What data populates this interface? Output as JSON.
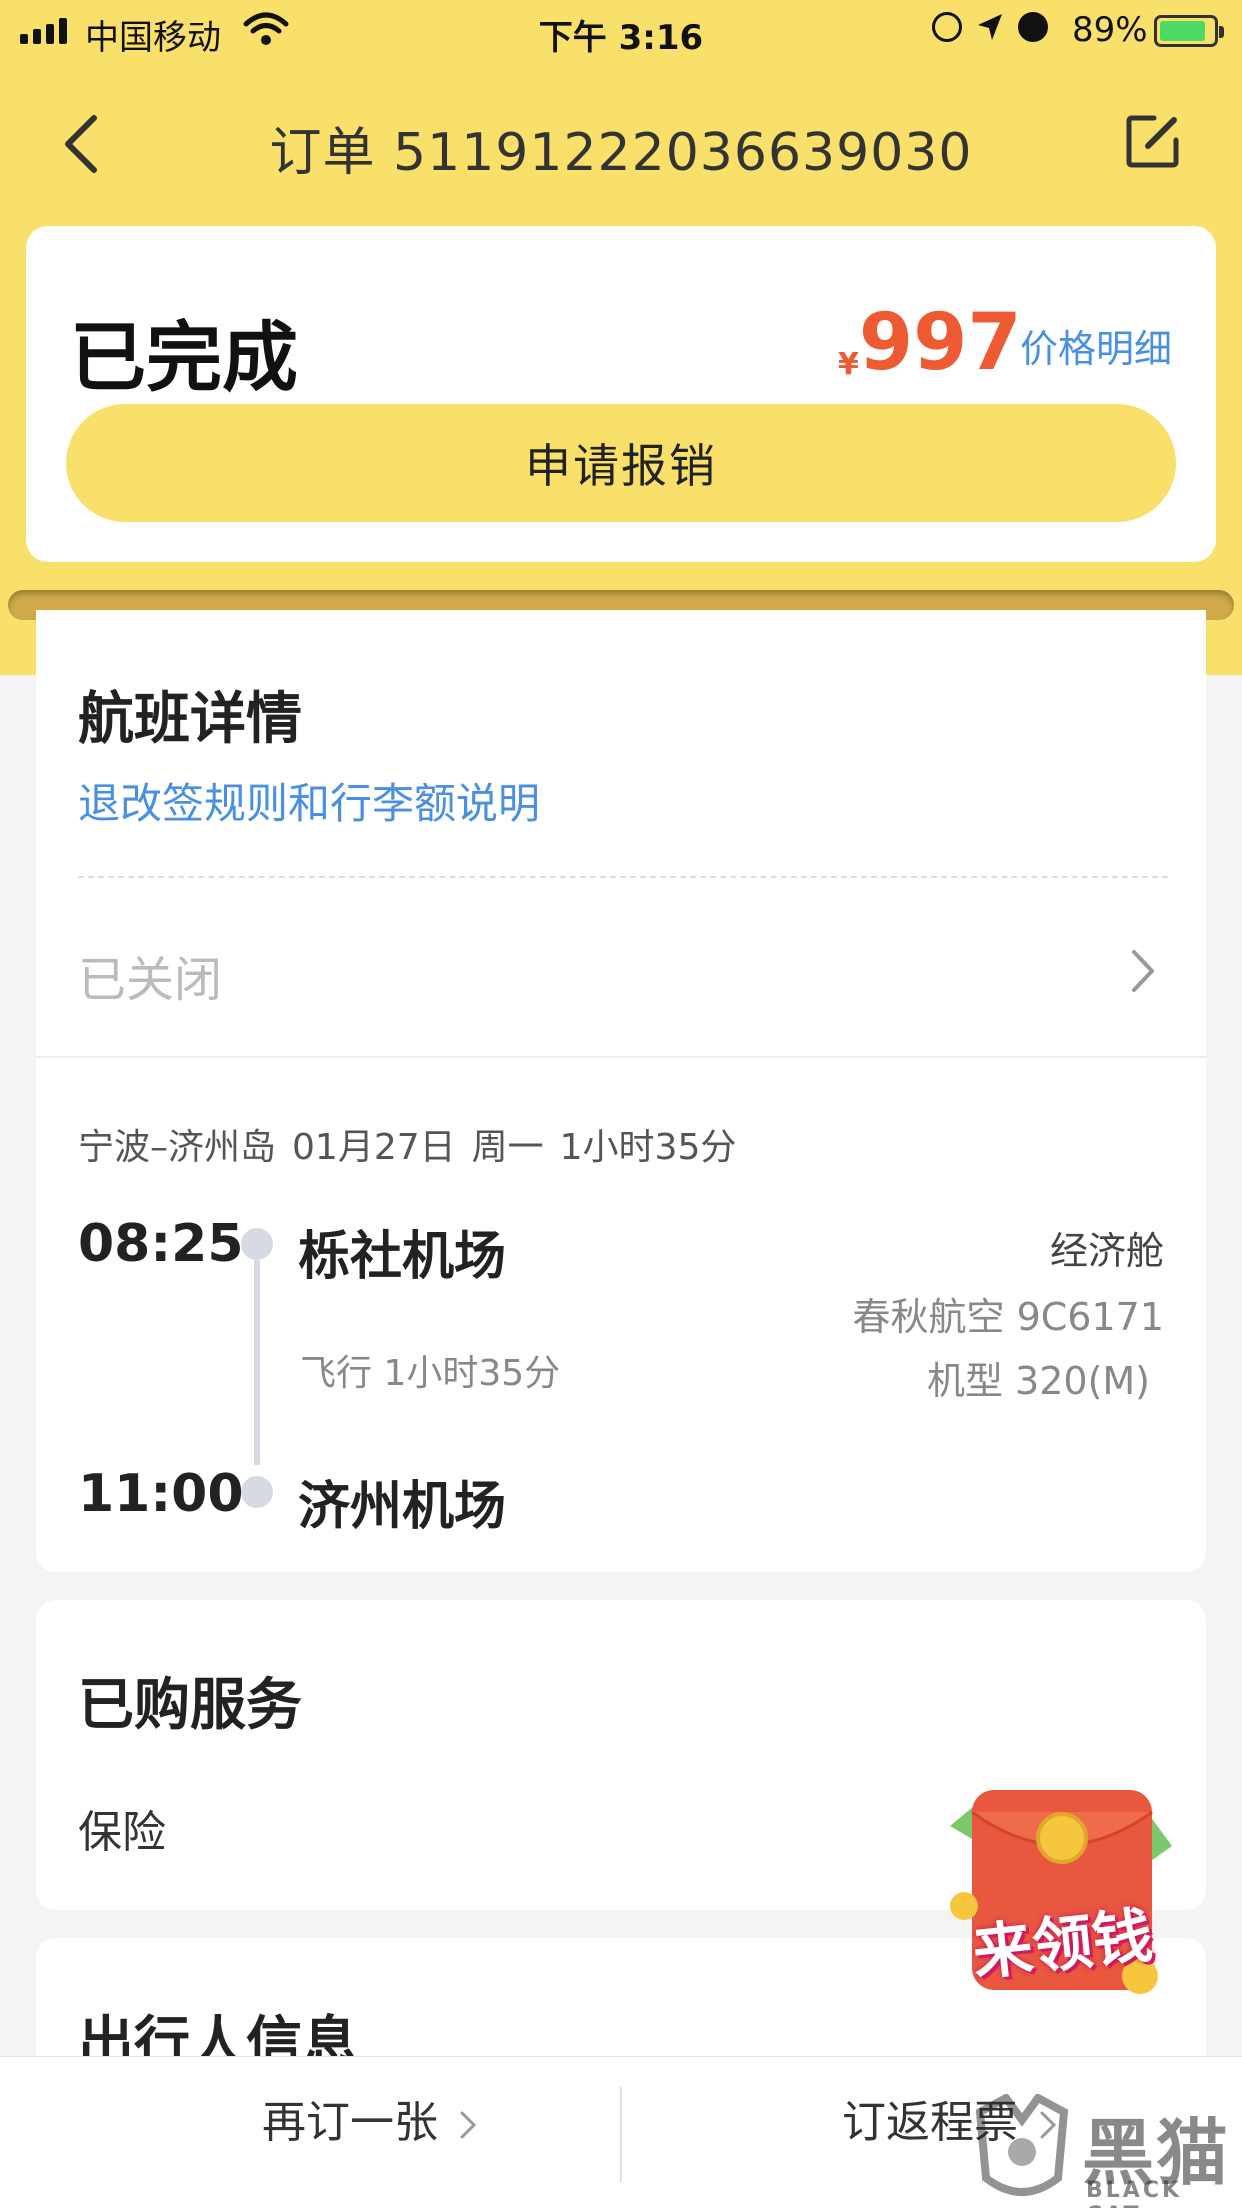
{
  "status_bar": {
    "carrier": "中国移动",
    "time": "下午 3:16",
    "battery": "89%"
  },
  "nav": {
    "title": "订单 5119122203663903​0"
  },
  "status_card": {
    "status": "已完成",
    "currency": "¥",
    "price": "997",
    "price_detail": "价格明细",
    "reimburse_button": "申请报销"
  },
  "flight": {
    "section_title": "航班详情",
    "rules_link": "退改签规则和行李额说明",
    "closed_label": "已关闭",
    "route": "宁波–济州岛",
    "date": "01月27日",
    "weekday": "周一",
    "total_duration": "1小时35分",
    "dep_time": "08:25",
    "dep_airport": "栎社机场",
    "arr_time": "11:00",
    "arr_airport": "济州机场",
    "fly_duration": "飞行 1小时35分",
    "cabin": "经济舱",
    "airline": "春秋航空 9C6171",
    "aircraft": "机型 320(M)"
  },
  "services": {
    "section_title": "已购服务",
    "insurance": "保险"
  },
  "traveler": {
    "section_title": "出行人信息"
  },
  "promo": {
    "label": "来领钱"
  },
  "bottom_bar": {
    "rebook": "再订一张",
    "return_ticket": "订返程票"
  },
  "watermark": {
    "cn": "黑猫",
    "en": "BLACK CAT"
  },
  "colors": {
    "header_yellow": "#f9e06a",
    "price_red": "#ee5a32",
    "link_blue": "#4a90e2"
  }
}
